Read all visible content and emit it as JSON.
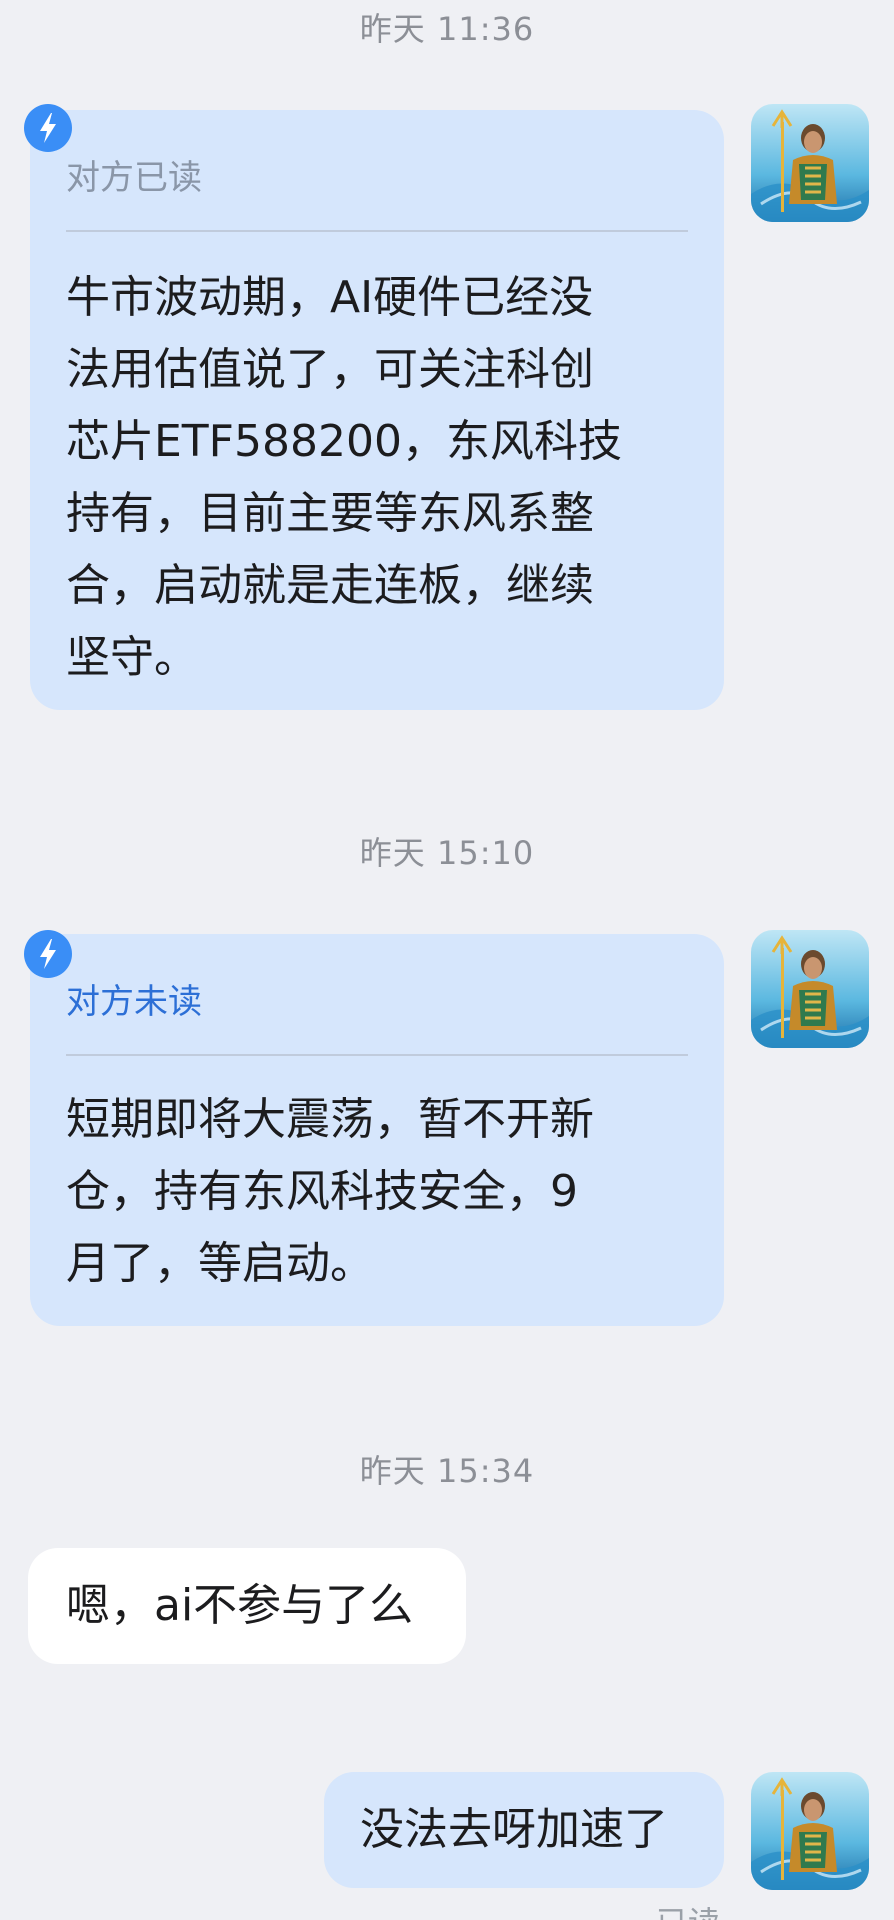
{
  "messages": [
    {
      "time": "昨天 11:36",
      "status": "对方已读",
      "text": "牛市波动期，AI硬件已经没法用估值说了，可关注科创芯片ETF588200，东风科技持有，目前主要等东风系整合，启动就是走连板，继续坚守。",
      "lines": [
        "牛市波动期，AI硬件已经没",
        "法用估值说了，可关注科创",
        "芯片ETF588200，东风科技",
        "持有，目前主要等东风系整",
        "合，启动就是走连板，继续",
        "坚守。"
      ]
    },
    {
      "time": "昨天 15:10",
      "status": "对方未读",
      "text": "短期即将大震荡，暂不开新仓，持有东风科技安全，9月了，等启动。",
      "lines": [
        "短期即将大震荡，暂不开新",
        "仓，持有东风科技安全，9",
        "月了，等启动。"
      ]
    },
    {
      "time": "昨天 15:34",
      "incoming_text": "嗯，ai不参与了么"
    },
    {
      "self_text": "没法去呀加速了",
      "status_partial": "已读"
    }
  ],
  "icons": {
    "avatar": "aquaman-avatar",
    "badge": "lightning-bolt-icon"
  },
  "colors": {
    "background": "#eff0f4",
    "outgoing_bubble": "#d6e6fc",
    "incoming_bubble": "#ffffff",
    "read_status": "#8a96a8",
    "unread_status": "#2c6fd6",
    "badge": "#3a8ef6"
  }
}
